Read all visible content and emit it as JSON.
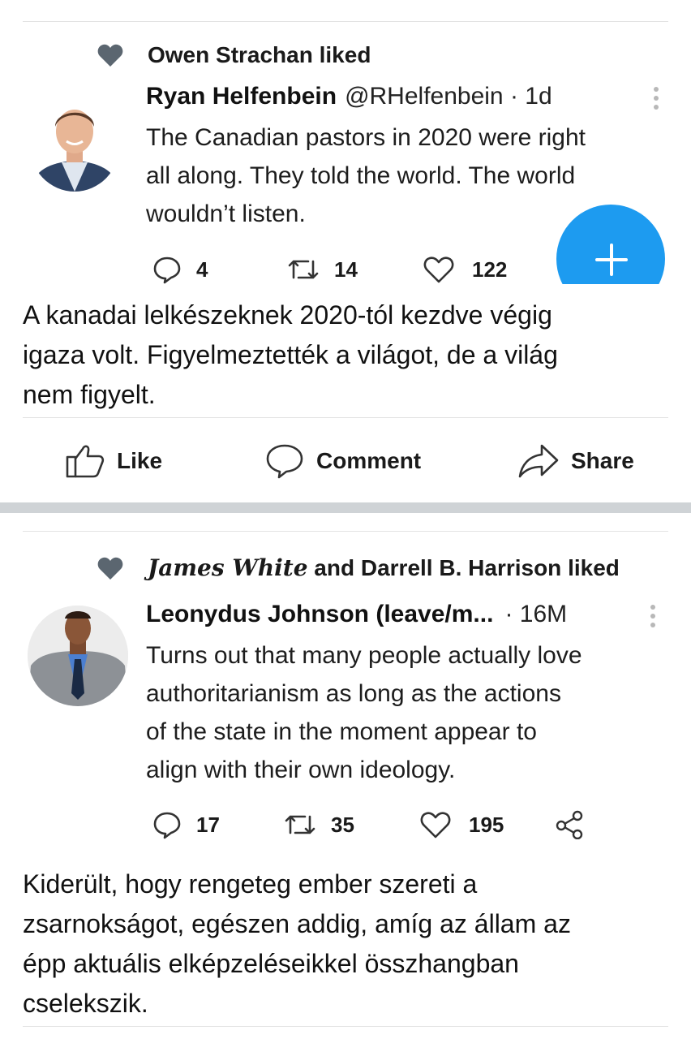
{
  "post1": {
    "liked_by": "Owen Strachan liked",
    "author_name": "Ryan Helfenbein",
    "handle_time": "@RHelfenbein · 1d",
    "text_lines": [
      "The Canadian pastors in 2020 were right",
      "all along. They told the world. The world",
      "wouldn’t listen."
    ],
    "replies": "4",
    "retweets": "14",
    "likes": "122",
    "caption_lines": [
      "A kanadai lelkészeknek 2020-tól kezdve végig",
      "igaza volt. Figyelmeztették a világot, de a világ",
      "nem figyelt."
    ]
  },
  "actions": {
    "like": "Like",
    "comment": "Comment",
    "share": "Share"
  },
  "post2": {
    "liked_by_part1": "James White",
    "liked_by_part2": " and Darrell B. Harrison liked",
    "author_name": "Leonydus Johnson (leave/m...",
    "time": "· 16M",
    "text_lines": [
      "Turns out that many people actually love",
      "authoritarianism as long as the actions",
      "of the state in the moment appear to",
      "align with their own ideology."
    ],
    "replies": "17",
    "retweets": "35",
    "likes": "195",
    "caption_lines": [
      "Kiderült, hogy rengeteg ember szereti a",
      "zsarnokságot, egészen addig, amíg az állam az",
      "épp aktuális elképzeléseikkel összhangban",
      "cselekszik."
    ]
  },
  "colors": {
    "fab": "#1d9bf0",
    "separator": "#cfd3d6",
    "heart_icon": "#5b6670"
  }
}
